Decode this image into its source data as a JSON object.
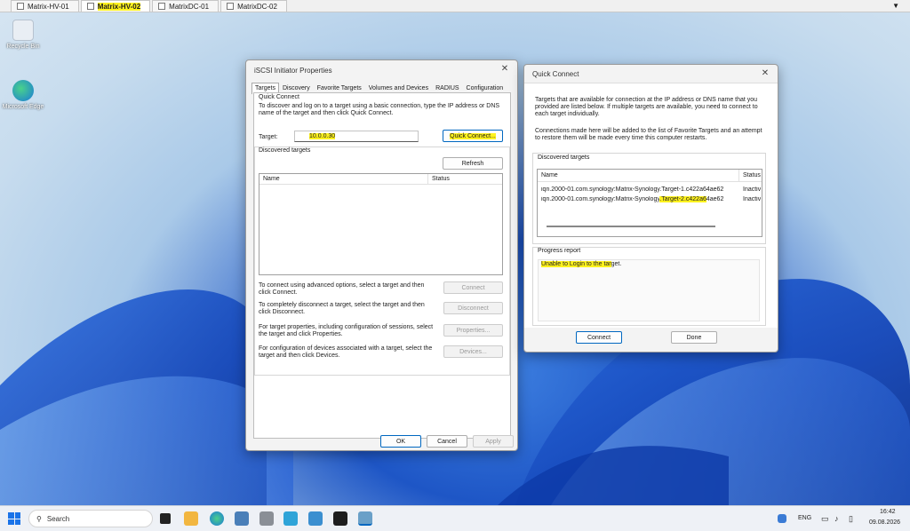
{
  "vm_tabs": [
    {
      "label": "Matrix-HV-01",
      "active": false
    },
    {
      "label": "Matrix-HV-02",
      "active": true
    },
    {
      "label": "MatrixDC-01",
      "active": false
    },
    {
      "label": "MatrixDC-02",
      "active": false
    }
  ],
  "desktop_icons": [
    {
      "label": "Recycle Bin",
      "icon": "recycle-bin-icon"
    },
    {
      "label": "Microsoft Edge",
      "icon": "edge-icon"
    }
  ],
  "iscsi": {
    "title": "iSCSI Initiator Properties",
    "tabs": [
      "Targets",
      "Discovery",
      "Favorite Targets",
      "Volumes and Devices",
      "RADIUS",
      "Configuration"
    ],
    "active_tab": "Targets",
    "quick_connect_label": "Quick Connect",
    "quick_connect_desc": "To discover and log on to a target using a basic connection, type the IP address or DNS name of the target and then click Quick Connect.",
    "target_label": "Target:",
    "target_value": "10.0.0.30",
    "quick_connect_button": "Quick Connect...",
    "discovered_label": "Discovered targets",
    "refresh_button": "Refresh",
    "col_name": "Name",
    "col_status": "Status",
    "connect_desc": "To connect using advanced options, select a target and then click Connect.",
    "connect_button": "Connect",
    "disconnect_desc": "To completely disconnect a target, select the target and then click Disconnect.",
    "disconnect_button": "Disconnect",
    "properties_desc": "For target properties, including configuration of sessions, select the target and click Properties.",
    "properties_button": "Properties...",
    "devices_desc": "For configuration of devices associated with a target, select the target and then click Devices.",
    "devices_button": "Devices...",
    "ok_button": "OK",
    "cancel_button": "Cancel",
    "apply_button": "Apply"
  },
  "quick": {
    "title": "Quick Connect",
    "desc1": "Targets that are available for connection at the IP address or DNS name that you provided are listed below.  If multiple targets are available, you need to connect to each target individually.",
    "desc2": "Connections made here will be added to the list of Favorite Targets and an attempt to restore them will be made every time this computer restarts.",
    "discovered_label": "Discovered targets",
    "col_name": "Name",
    "col_status": "Status",
    "rows": [
      {
        "name": "iqn.2000-01.com.synology:Matrix-Synology.Target-1.c422a64ae62",
        "status": "Inactiv"
      },
      {
        "name_prefix": "iqn.2000-01.com.synology:Matrix-Synology",
        "name_hl": ".Target-2.c422a6",
        "name_suffix": "4ae62",
        "status": "Inactiv"
      }
    ],
    "progress_label": "Progress report",
    "progress_hl": "Unable to Login to the tar",
    "progress_rest": "get.",
    "connect_button": "Connect",
    "done_button": "Done"
  },
  "taskbar": {
    "search_placeholder": "Search",
    "lang": "ENG",
    "time": "16:42",
    "date": "09.08.2026"
  }
}
